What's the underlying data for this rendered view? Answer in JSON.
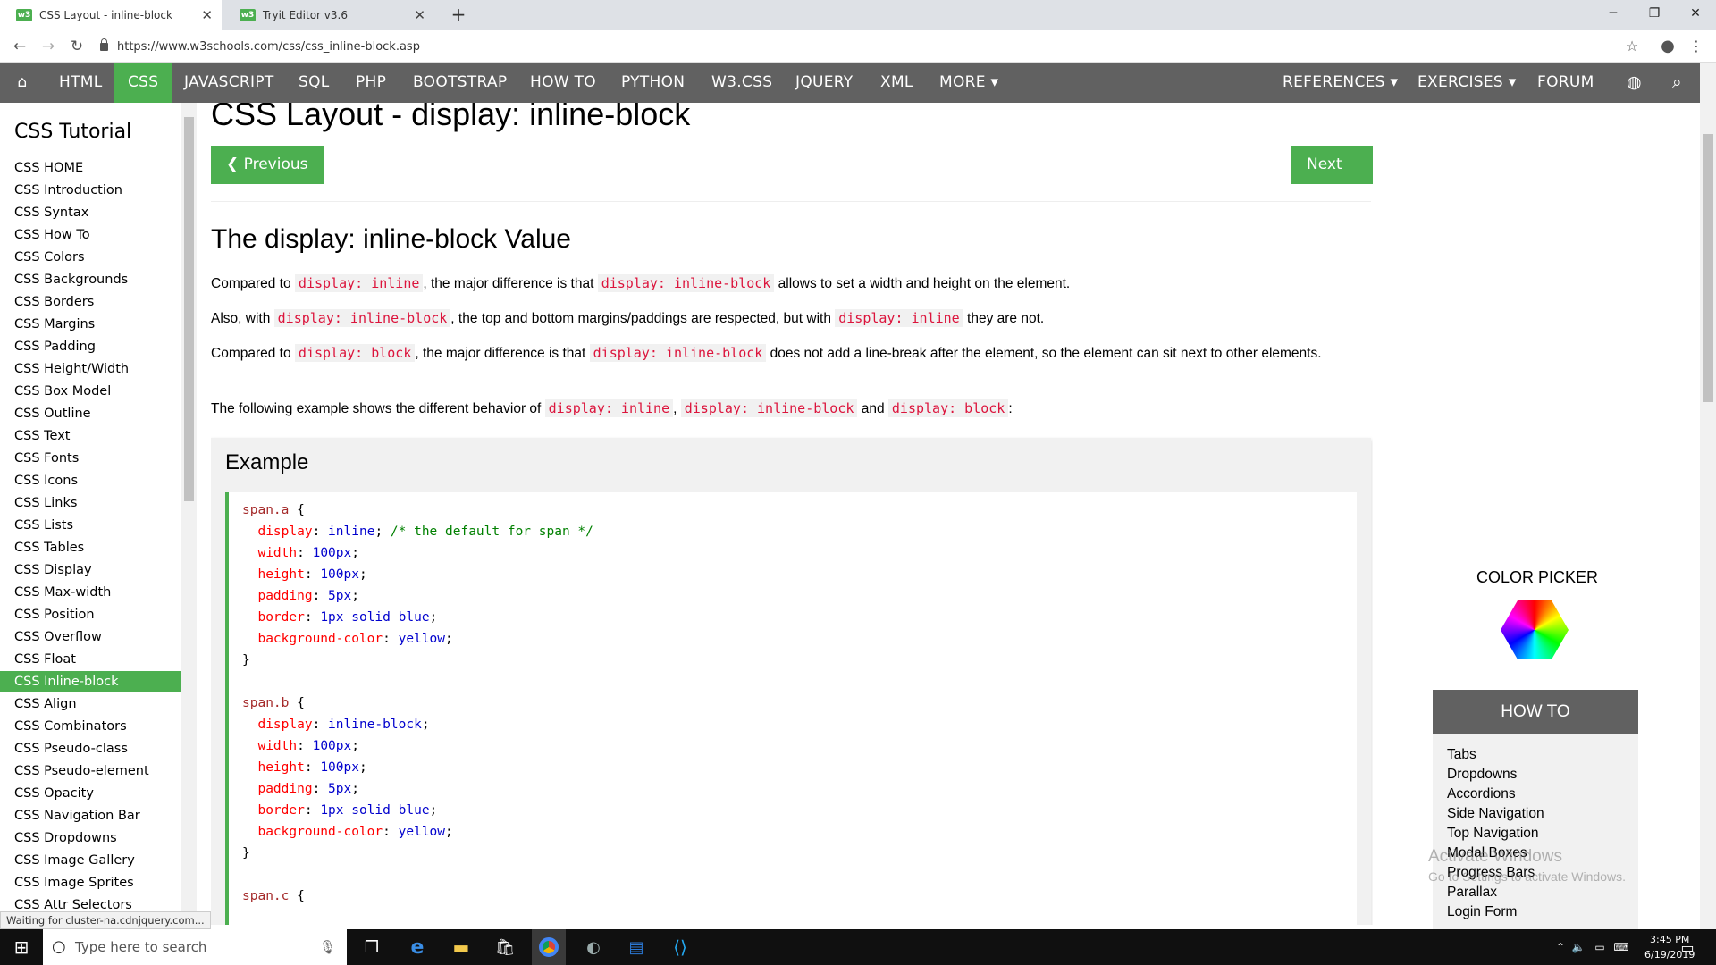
{
  "browser": {
    "tabs": [
      {
        "title": "CSS Layout - inline-block",
        "favicon": "w3"
      },
      {
        "title": "Tryit Editor v3.6",
        "favicon": "w3"
      }
    ],
    "url": "https://www.w3schools.com/css/css_inline-block.asp"
  },
  "topnav": {
    "items": [
      "HTML",
      "CSS",
      "JAVASCRIPT",
      "SQL",
      "PHP",
      "BOOTSTRAP",
      "HOW TO",
      "PYTHON",
      "W3.CSS",
      "JQUERY",
      "XML",
      "MORE ▾"
    ],
    "active": "CSS",
    "right_items": [
      "REFERENCES ▾",
      "EXERCISES ▾",
      "FORUM"
    ]
  },
  "sidebar": {
    "title": "CSS Tutorial",
    "items": [
      "CSS HOME",
      "CSS Introduction",
      "CSS Syntax",
      "CSS How To",
      "CSS Colors",
      "CSS Backgrounds",
      "CSS Borders",
      "CSS Margins",
      "CSS Padding",
      "CSS Height/Width",
      "CSS Box Model",
      "CSS Outline",
      "CSS Text",
      "CSS Fonts",
      "CSS Icons",
      "CSS Links",
      "CSS Lists",
      "CSS Tables",
      "CSS Display",
      "CSS Max-width",
      "CSS Position",
      "CSS Overflow",
      "CSS Float",
      "CSS Inline-block",
      "CSS Align",
      "CSS Combinators",
      "CSS Pseudo-class",
      "CSS Pseudo-element",
      "CSS Opacity",
      "CSS Navigation Bar",
      "CSS Dropdowns",
      "CSS Image Gallery",
      "CSS Image Sprites",
      "CSS Attr Selectors"
    ],
    "active": "CSS Inline-block"
  },
  "main": {
    "h1": "CSS Layout - display: inline-block",
    "prev": "❮ Previous",
    "next": "Next ❯",
    "h2": "The display: inline-block Value",
    "p1": {
      "a": "Compared to ",
      "c1": "display: inline",
      "b": ", the major difference is that ",
      "c2": "display: inline-block",
      "c": " allows to set a width and height on the element."
    },
    "p2": {
      "a": "Also, with ",
      "c1": "display: inline-block",
      "b": ", the top and bottom margins/paddings are respected, but with ",
      "c2": "display: inline",
      "c": " they are not."
    },
    "p3": {
      "a": "Compared to ",
      "c1": "display: block",
      "b": ", the major difference is that ",
      "c2": "display: inline-block",
      "c": " does not add a line-break after the element, so the element can sit next to other elements."
    },
    "p4": {
      "a": "The following example shows the different behavior of ",
      "c1": "display: inline",
      "b": ", ",
      "c2": "display: inline-block",
      "c": " and ",
      "c3": "display: block",
      "d": ":"
    },
    "example_title": "Example"
  },
  "code": {
    "a_sel": "span.a",
    "b_sel": "span.b",
    "c_sel": "span.c",
    "open": " {",
    "close": "}",
    "display": "display",
    "width": "width",
    "height": "height",
    "padding": "padding",
    "border": "border",
    "bg": "background-color",
    "inline": "inline",
    "inline_block": "inline-block",
    "comment": "/* the default for span */",
    "v100": "100px",
    "v5": "5px",
    "border_v": "1px solid blue",
    "yellow": "yellow"
  },
  "right": {
    "color_picker": "COLOR PICKER",
    "howto_title": "HOW TO",
    "howto_items": [
      "Tabs",
      "Dropdowns",
      "Accordions",
      "Side Navigation",
      "Top Navigation",
      "Modal Boxes",
      "Progress Bars",
      "Parallax",
      "Login Form"
    ]
  },
  "watermark": {
    "line1": "Activate Windows",
    "line2": "Go to Settings to activate Windows."
  },
  "status": "Waiting for cluster-na.cdnjquery.com...",
  "taskbar": {
    "search_placeholder": "Type here to search",
    "time": "3:45 PM",
    "date": "6/19/2019"
  },
  "colors": {
    "accent": "#4caf50",
    "nav": "#616161",
    "code_red": "#dc143c"
  }
}
